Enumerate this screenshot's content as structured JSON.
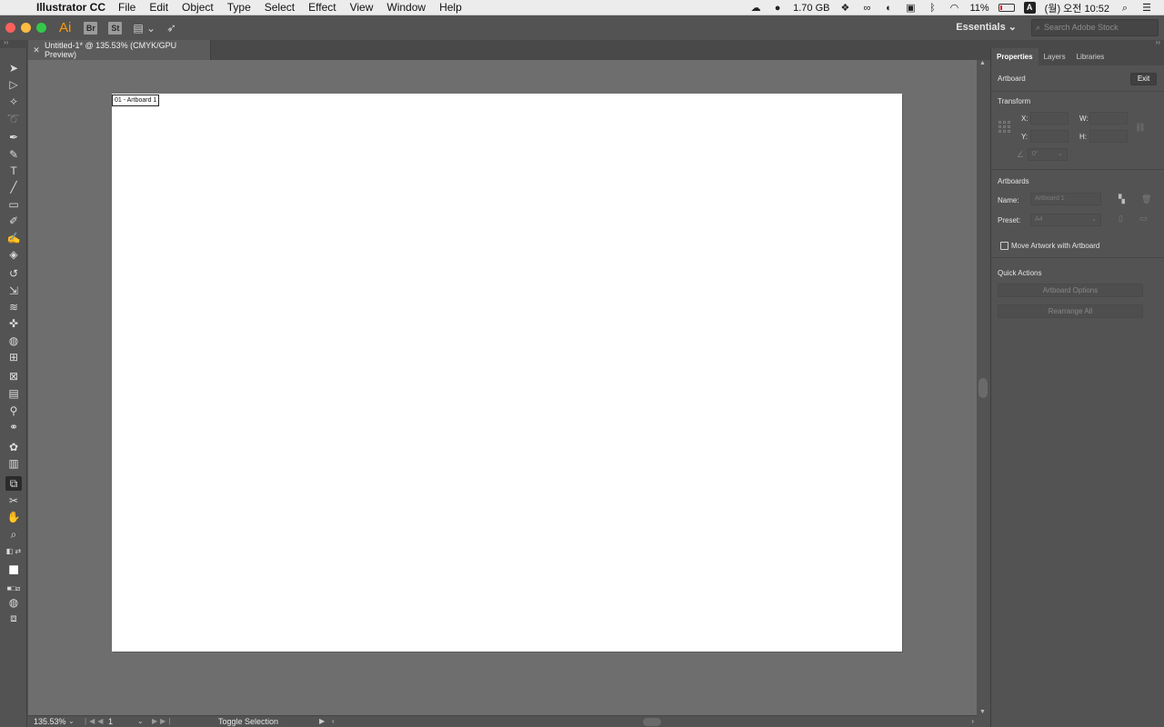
{
  "menubar": {
    "app_name": "Illustrator CC",
    "items": [
      "File",
      "Edit",
      "Object",
      "Type",
      "Select",
      "Effect",
      "View",
      "Window",
      "Help"
    ],
    "memory": "1.70 GB",
    "battery_percent": "11%",
    "battery_level": 0.11,
    "input_source": "A",
    "clock": "(월) 오전 10:52"
  },
  "appbar": {
    "logo": "Ai",
    "bridge_label": "Br",
    "stock_label": "St",
    "workspace": "Essentials",
    "search_placeholder": "Search Adobe Stock"
  },
  "document": {
    "tab_title": "Untitled-1* @ 135.53% (CMYK/GPU Preview)",
    "artboard_label": "01 - Artboard 1"
  },
  "status": {
    "zoom": "135.53%",
    "page": "1",
    "toggle_label": "Toggle Selection"
  },
  "panel": {
    "tabs": [
      "Properties",
      "Layers",
      "Libraries"
    ],
    "section_artboard": "Artboard",
    "exit_label": "Exit",
    "section_transform": "Transform",
    "x_label": "X:",
    "y_label": "Y:",
    "w_label": "W:",
    "h_label": "H:",
    "angle_value": "0°",
    "section_artboards": "Artboards",
    "name_label": "Name:",
    "name_value": "Artboard 1",
    "preset_label": "Preset:",
    "preset_value": "A4",
    "move_artwork_label": "Move Artwork with Artboard",
    "section_quick_actions": "Quick Actions",
    "artboard_options_label": "Artboard Options",
    "rearrange_all_label": "Rearrange All"
  },
  "colors": {
    "accent_logo": "#ff9a00",
    "close": "#fc605c",
    "minimize": "#fdbc40",
    "zoom": "#34c84a",
    "canvas_bg": "#6e6e6e",
    "ui_bg": "#535353"
  }
}
